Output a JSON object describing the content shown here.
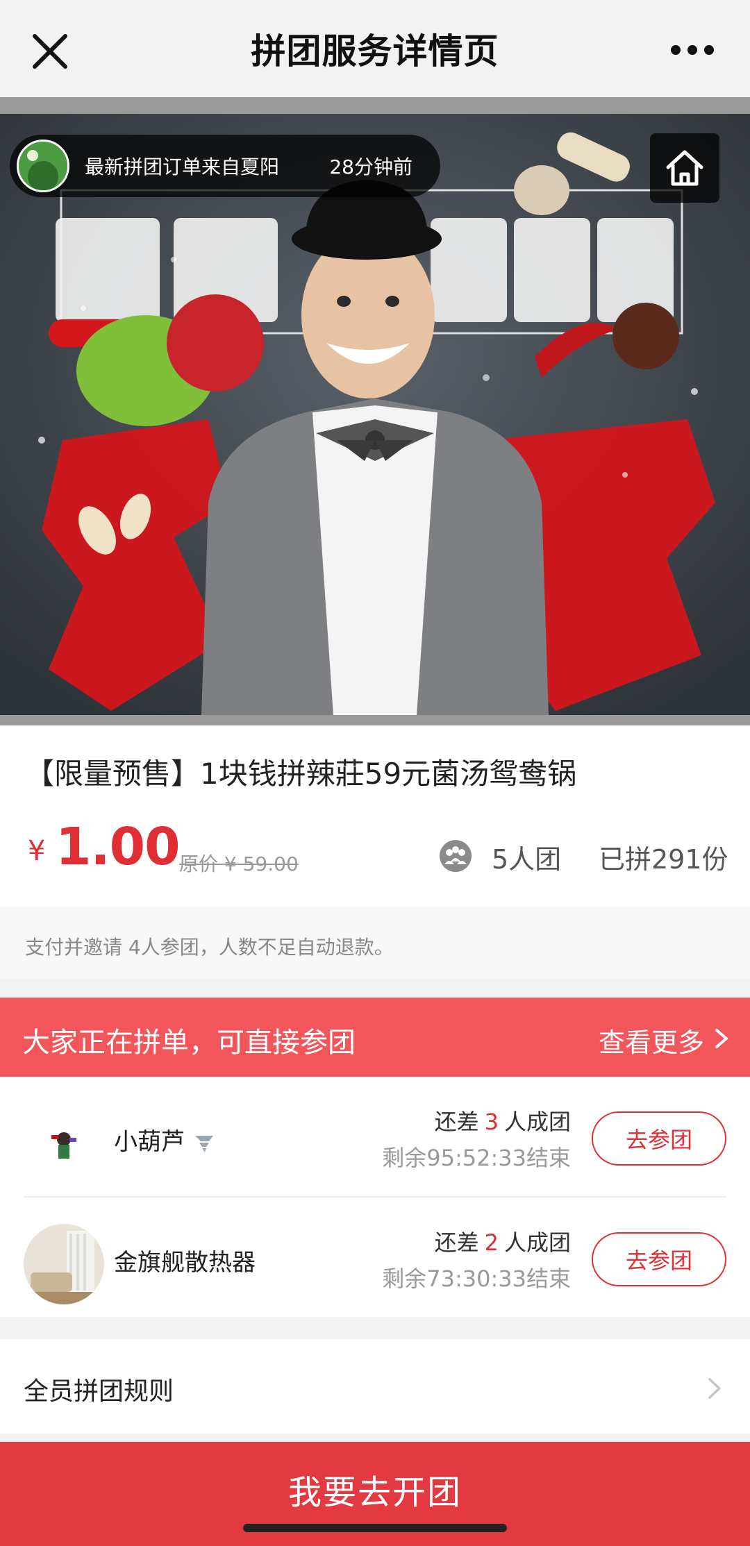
{
  "nav": {
    "title": "拼团服务详情页"
  },
  "hero": {
    "recent_order_text": "最新拼团订单来自夏阳",
    "recent_order_time": "28分钟前"
  },
  "product": {
    "title": "【限量预售】1块钱拼辣莊59元菌汤鸳鸯锅",
    "price_symbol": "¥",
    "price": "1.00",
    "original_price": "原价 ¥ 59.00",
    "group_size": "5人团",
    "sold": "已拼291份"
  },
  "notice": "支付并邀请 4人参团，人数不足自动退款。",
  "join_section": {
    "title": "大家正在拼单，可直接参团",
    "more": "查看更多"
  },
  "groups": [
    {
      "name": "小葫芦",
      "need_prefix": "还差",
      "need_count": "3",
      "need_suffix": "人成团",
      "time_left": "剩余95:52:33结束",
      "button": "去参团"
    },
    {
      "name": "金旗舰散热器",
      "need_prefix": "还差",
      "need_count": "2",
      "need_suffix": "人成团",
      "time_left": "剩余73:30:33结束",
      "button": "去参团"
    }
  ],
  "rules": {
    "label": "全员拼团规则"
  },
  "cta": {
    "label": "我要去开团"
  },
  "colors": {
    "accent_red": "#e02e35",
    "join_bar": "#f2555a",
    "cta": "#e23a40"
  }
}
